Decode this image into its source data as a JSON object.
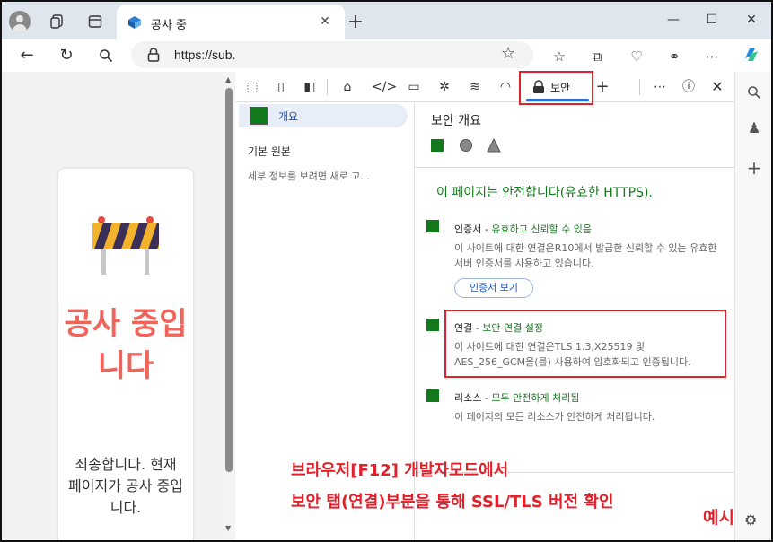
{
  "browser": {
    "tab_title": "공사 중",
    "url": "https://sub.",
    "close_tab": "✕",
    "new_tab": "+"
  },
  "devtools": {
    "security_tab_label": "보안",
    "sidebar": {
      "overview_label": "개요",
      "main_origin_heading": "기본 원본",
      "main_origin_note": "세부 정보를 보려면 새로 고..."
    },
    "main": {
      "title": "보안 개요",
      "summary": "이 페이지는 안전합니다(유효한 HTTPS).",
      "certificate": {
        "label": "인증서",
        "status": "유효하고 신뢰할 수 있음",
        "description": "이 사이트에 대한 연결은R10에서 발급한 신뢰할 수 있는 유효한 서버 인증서를 사용하고 있습니다.",
        "button": "인증서 보기"
      },
      "connection": {
        "label": "연결",
        "status": "보안 연결 설정",
        "description": "이 사이트에 대한 연결은TLS 1.3,X25519 및 AES_256_GCM을(를) 사용하여 암호화되고 인증됩니다."
      },
      "resources": {
        "label": "리소스",
        "status": "모두 안전하게 처리됨",
        "description": "이 페이지의 모든 리소스가 안전하게 처리됩니다."
      }
    }
  },
  "webpage": {
    "title": "공사 중입니다",
    "body": "죄송합니다. 현재 페이지가 공사 중입니다."
  },
  "annotations": {
    "line1": "브라우저[F12] 개발자모드에서",
    "line2": "보안 탭(연결)부분을 통해 SSL/TLS 버전 확인",
    "example": "예시"
  },
  "colors": {
    "secure_green": "#127a1c",
    "annotation_red": "#e0202a",
    "construction_title": "#f0645a",
    "link_blue": "#1a56b8"
  }
}
